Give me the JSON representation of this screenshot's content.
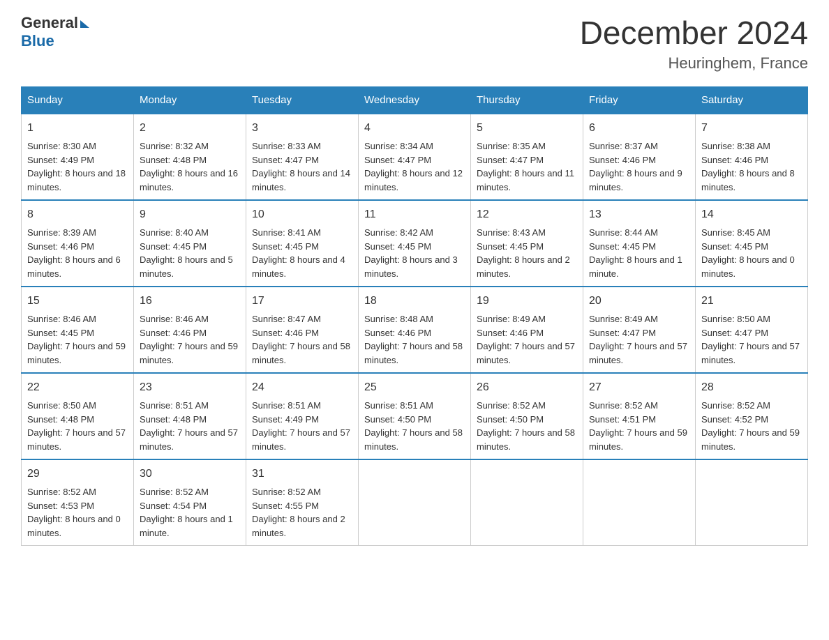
{
  "header": {
    "logo_general": "General",
    "logo_blue": "Blue",
    "month_title": "December 2024",
    "location": "Heuringhem, France"
  },
  "days_of_week": [
    "Sunday",
    "Monday",
    "Tuesday",
    "Wednesday",
    "Thursday",
    "Friday",
    "Saturday"
  ],
  "weeks": [
    [
      {
        "num": "1",
        "sunrise": "8:30 AM",
        "sunset": "4:49 PM",
        "daylight": "8 hours and 18 minutes."
      },
      {
        "num": "2",
        "sunrise": "8:32 AM",
        "sunset": "4:48 PM",
        "daylight": "8 hours and 16 minutes."
      },
      {
        "num": "3",
        "sunrise": "8:33 AM",
        "sunset": "4:47 PM",
        "daylight": "8 hours and 14 minutes."
      },
      {
        "num": "4",
        "sunrise": "8:34 AM",
        "sunset": "4:47 PM",
        "daylight": "8 hours and 12 minutes."
      },
      {
        "num": "5",
        "sunrise": "8:35 AM",
        "sunset": "4:47 PM",
        "daylight": "8 hours and 11 minutes."
      },
      {
        "num": "6",
        "sunrise": "8:37 AM",
        "sunset": "4:46 PM",
        "daylight": "8 hours and 9 minutes."
      },
      {
        "num": "7",
        "sunrise": "8:38 AM",
        "sunset": "4:46 PM",
        "daylight": "8 hours and 8 minutes."
      }
    ],
    [
      {
        "num": "8",
        "sunrise": "8:39 AM",
        "sunset": "4:46 PM",
        "daylight": "8 hours and 6 minutes."
      },
      {
        "num": "9",
        "sunrise": "8:40 AM",
        "sunset": "4:45 PM",
        "daylight": "8 hours and 5 minutes."
      },
      {
        "num": "10",
        "sunrise": "8:41 AM",
        "sunset": "4:45 PM",
        "daylight": "8 hours and 4 minutes."
      },
      {
        "num": "11",
        "sunrise": "8:42 AM",
        "sunset": "4:45 PM",
        "daylight": "8 hours and 3 minutes."
      },
      {
        "num": "12",
        "sunrise": "8:43 AM",
        "sunset": "4:45 PM",
        "daylight": "8 hours and 2 minutes."
      },
      {
        "num": "13",
        "sunrise": "8:44 AM",
        "sunset": "4:45 PM",
        "daylight": "8 hours and 1 minute."
      },
      {
        "num": "14",
        "sunrise": "8:45 AM",
        "sunset": "4:45 PM",
        "daylight": "8 hours and 0 minutes."
      }
    ],
    [
      {
        "num": "15",
        "sunrise": "8:46 AM",
        "sunset": "4:45 PM",
        "daylight": "7 hours and 59 minutes."
      },
      {
        "num": "16",
        "sunrise": "8:46 AM",
        "sunset": "4:46 PM",
        "daylight": "7 hours and 59 minutes."
      },
      {
        "num": "17",
        "sunrise": "8:47 AM",
        "sunset": "4:46 PM",
        "daylight": "7 hours and 58 minutes."
      },
      {
        "num": "18",
        "sunrise": "8:48 AM",
        "sunset": "4:46 PM",
        "daylight": "7 hours and 58 minutes."
      },
      {
        "num": "19",
        "sunrise": "8:49 AM",
        "sunset": "4:46 PM",
        "daylight": "7 hours and 57 minutes."
      },
      {
        "num": "20",
        "sunrise": "8:49 AM",
        "sunset": "4:47 PM",
        "daylight": "7 hours and 57 minutes."
      },
      {
        "num": "21",
        "sunrise": "8:50 AM",
        "sunset": "4:47 PM",
        "daylight": "7 hours and 57 minutes."
      }
    ],
    [
      {
        "num": "22",
        "sunrise": "8:50 AM",
        "sunset": "4:48 PM",
        "daylight": "7 hours and 57 minutes."
      },
      {
        "num": "23",
        "sunrise": "8:51 AM",
        "sunset": "4:48 PM",
        "daylight": "7 hours and 57 minutes."
      },
      {
        "num": "24",
        "sunrise": "8:51 AM",
        "sunset": "4:49 PM",
        "daylight": "7 hours and 57 minutes."
      },
      {
        "num": "25",
        "sunrise": "8:51 AM",
        "sunset": "4:50 PM",
        "daylight": "7 hours and 58 minutes."
      },
      {
        "num": "26",
        "sunrise": "8:52 AM",
        "sunset": "4:50 PM",
        "daylight": "7 hours and 58 minutes."
      },
      {
        "num": "27",
        "sunrise": "8:52 AM",
        "sunset": "4:51 PM",
        "daylight": "7 hours and 59 minutes."
      },
      {
        "num": "28",
        "sunrise": "8:52 AM",
        "sunset": "4:52 PM",
        "daylight": "7 hours and 59 minutes."
      }
    ],
    [
      {
        "num": "29",
        "sunrise": "8:52 AM",
        "sunset": "4:53 PM",
        "daylight": "8 hours and 0 minutes."
      },
      {
        "num": "30",
        "sunrise": "8:52 AM",
        "sunset": "4:54 PM",
        "daylight": "8 hours and 1 minute."
      },
      {
        "num": "31",
        "sunrise": "8:52 AM",
        "sunset": "4:55 PM",
        "daylight": "8 hours and 2 minutes."
      },
      null,
      null,
      null,
      null
    ]
  ],
  "labels": {
    "sunrise_prefix": "Sunrise: ",
    "sunset_prefix": "Sunset: ",
    "daylight_prefix": "Daylight: "
  }
}
